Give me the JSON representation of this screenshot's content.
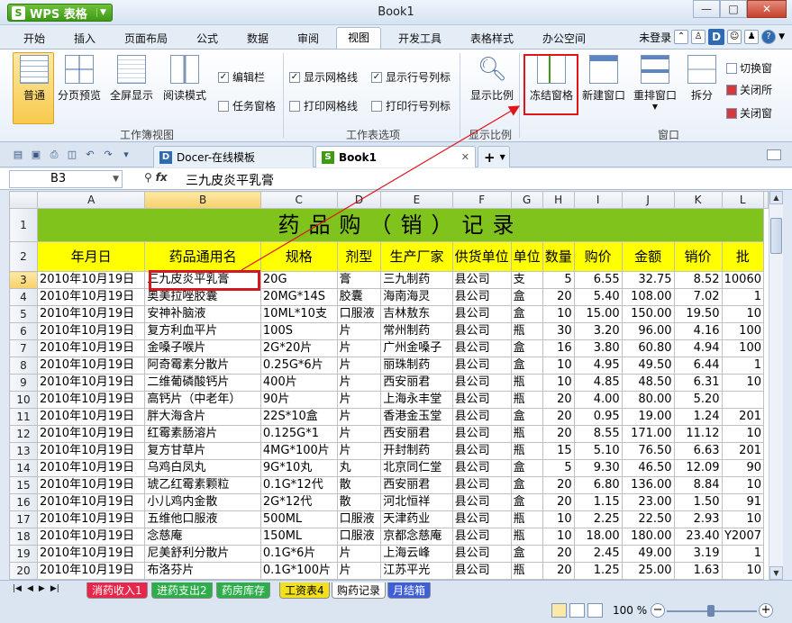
{
  "app": {
    "menu_label": "WPS 表格",
    "logo_letter": "S",
    "window_title": "Book1",
    "minimize": "—",
    "maximize": "□",
    "close": "✕"
  },
  "menu": {
    "tabs": [
      "开始",
      "插入",
      "页面布局",
      "公式",
      "数据",
      "审阅",
      "视图",
      "开发工具",
      "表格样式",
      "办公空间"
    ],
    "active_tab": "视图",
    "login": "未登录",
    "d_badge": "D"
  },
  "ribbon": {
    "view_buttons": [
      "普通",
      "分页预览",
      "全屏显示",
      "阅读模式"
    ],
    "checks_a": [
      {
        "label": "编辑栏",
        "checked": true
      },
      {
        "label": "任务窗格",
        "checked": false
      }
    ],
    "checks_b": [
      {
        "label": "显示网格线",
        "checked": true
      },
      {
        "label": "打印网格线",
        "checked": false
      }
    ],
    "checks_c": [
      {
        "label": "显示行号列标",
        "checked": true
      },
      {
        "label": "打印行号列标",
        "checked": false
      }
    ],
    "zoom_button": "显示比例",
    "freeze_button": "冻结窗格",
    "new_window": "新建窗口",
    "rearrange": "重排窗口",
    "split": "拆分",
    "side_items": [
      "切换窗",
      "关闭所",
      "关闭窗"
    ],
    "groups": [
      "工作簿视图",
      "工作表选项",
      "显示比例",
      "窗口"
    ]
  },
  "doc_tabs": {
    "tab1": "Docer-在线模板",
    "tab1_icon": "D",
    "tab2": "Book1",
    "tab2_icon": "S",
    "plus": "+"
  },
  "formula_bar": {
    "cell_ref": "B3",
    "fx": "fx",
    "content": "三九皮炎平乳膏"
  },
  "sheet": {
    "columns": [
      "A",
      "B",
      "C",
      "D",
      "E",
      "F",
      "G",
      "H",
      "I",
      "J",
      "K",
      "L"
    ],
    "selected_col": "B",
    "title": "药品购（销）记录",
    "headers": [
      "年月日",
      "药品通用名",
      "规格",
      "剂型",
      "生产厂家",
      "供货单位",
      "单位",
      "数量",
      "购价",
      "金额",
      "销价",
      "批"
    ],
    "rows": [
      {
        "n": "3",
        "c": [
          "2010年10月19日",
          "三九皮炎平乳膏",
          "20G",
          "膏",
          "三九制药",
          "县公司",
          "支",
          "5",
          "6.55",
          "32.75",
          "8.52",
          "10060"
        ]
      },
      {
        "n": "4",
        "c": [
          "2010年10月19日",
          "奥美拉唑胶囊",
          "20MG*14S",
          "胶囊",
          "海南海灵",
          "县公司",
          "盒",
          "20",
          "5.40",
          "108.00",
          "7.02",
          "1"
        ]
      },
      {
        "n": "5",
        "c": [
          "2010年10月19日",
          "安神补脑液",
          "10ML*10支",
          "口服液",
          "吉林敖东",
          "县公司",
          "盒",
          "10",
          "15.00",
          "150.00",
          "19.50",
          "10"
        ]
      },
      {
        "n": "6",
        "c": [
          "2010年10月19日",
          "复方利血平片",
          "100S",
          "片",
          "常州制药",
          "县公司",
          "瓶",
          "30",
          "3.20",
          "96.00",
          "4.16",
          "100"
        ]
      },
      {
        "n": "7",
        "c": [
          "2010年10月19日",
          "金嗓子喉片",
          "2G*20片",
          "片",
          "广州金嗓子",
          "县公司",
          "盒",
          "16",
          "3.80",
          "60.80",
          "4.94",
          "100"
        ]
      },
      {
        "n": "8",
        "c": [
          "2010年10月19日",
          "阿奇霉素分散片",
          "0.25G*6片",
          "片",
          "丽珠制药",
          "县公司",
          "盒",
          "10",
          "4.95",
          "49.50",
          "6.44",
          "1"
        ]
      },
      {
        "n": "9",
        "c": [
          "2010年10月19日",
          "二维葡磷酸钙片",
          "400片",
          "片",
          "西安丽君",
          "县公司",
          "瓶",
          "10",
          "4.85",
          "48.50",
          "6.31",
          "10"
        ]
      },
      {
        "n": "10",
        "c": [
          "2010年10月19日",
          "高钙片（中老年）",
          "90片",
          "片",
          "上海永丰堂",
          "县公司",
          "瓶",
          "20",
          "4.00",
          "80.00",
          "5.20",
          ""
        ]
      },
      {
        "n": "11",
        "c": [
          "2010年10月19日",
          "胖大海含片",
          "22S*10盒",
          "片",
          "香港金玉堂",
          "县公司",
          "盒",
          "20",
          "0.95",
          "19.00",
          "1.24",
          "201"
        ]
      },
      {
        "n": "12",
        "c": [
          "2010年10月19日",
          "红霉素肠溶片",
          "0.125G*1",
          "片",
          "西安丽君",
          "县公司",
          "瓶",
          "20",
          "8.55",
          "171.00",
          "11.12",
          "10"
        ]
      },
      {
        "n": "13",
        "c": [
          "2010年10月19日",
          "复方甘草片",
          "4MG*100片",
          "片",
          "开封制药",
          "县公司",
          "瓶",
          "15",
          "5.10",
          "76.50",
          "6.63",
          "201"
        ]
      },
      {
        "n": "14",
        "c": [
          "2010年10月19日",
          "乌鸡白凤丸",
          "9G*10丸",
          "丸",
          "北京同仁堂",
          "县公司",
          "盒",
          "5",
          "9.30",
          "46.50",
          "12.09",
          "90"
        ]
      },
      {
        "n": "15",
        "c": [
          "2010年10月19日",
          "琥乙红霉素颗粒",
          "0.1G*12代",
          "散",
          "西安丽君",
          "县公司",
          "盒",
          "20",
          "6.80",
          "136.00",
          "8.84",
          "10"
        ]
      },
      {
        "n": "16",
        "c": [
          "2010年10月19日",
          "小儿鸡内金散",
          "2G*12代",
          "散",
          "河北恒祥",
          "县公司",
          "盒",
          "20",
          "1.15",
          "23.00",
          "1.50",
          "91"
        ]
      },
      {
        "n": "17",
        "c": [
          "2010年10月19日",
          "五维他口服液",
          "500ML",
          "口服液",
          "天津药业",
          "县公司",
          "瓶",
          "10",
          "2.25",
          "22.50",
          "2.93",
          "10"
        ]
      },
      {
        "n": "18",
        "c": [
          "2010年10月19日",
          "念慈庵",
          "150ML",
          "口服液",
          "京都念慈庵",
          "县公司",
          "瓶",
          "10",
          "18.00",
          "180.00",
          "23.40",
          "Y2007"
        ]
      },
      {
        "n": "19",
        "c": [
          "2010年10月19日",
          "尼美舒利分散片",
          "0.1G*6片",
          "片",
          "上海云峰",
          "县公司",
          "盒",
          "20",
          "2.45",
          "49.00",
          "3.19",
          "1"
        ]
      },
      {
        "n": "20",
        "c": [
          "2010年10月19日",
          "布洛芬片",
          "0.1G*100片",
          "片",
          "江苏平光",
          "县公司",
          "瓶",
          "20",
          "1.25",
          "25.00",
          "1.63",
          "10"
        ]
      }
    ]
  },
  "sheet_tabs": [
    {
      "label": "消药收入1",
      "bg": "#e8264a",
      "fg": "#ffffff"
    },
    {
      "label": "进药支出2",
      "bg": "#2eae4a",
      "fg": "#ffffff"
    },
    {
      "label": "药房库存",
      "bg": "#2eae4a",
      "fg": "#ffffff"
    },
    {
      "label": "工资表4",
      "bg": "#f2e01a",
      "fg": "#000000"
    },
    {
      "label": "购药记录",
      "bg": "#ffffff",
      "fg": "#000000"
    },
    {
      "label": "月结箱",
      "bg": "#3f5fd8",
      "fg": "#ffffff"
    }
  ],
  "status": {
    "zoom": "100 %",
    "minus": "−",
    "plus": "+"
  },
  "colors": {
    "title_row_bg": "#7fc31c",
    "header_row_bg": "#ffff00",
    "highlight_red": "#e0141b"
  }
}
